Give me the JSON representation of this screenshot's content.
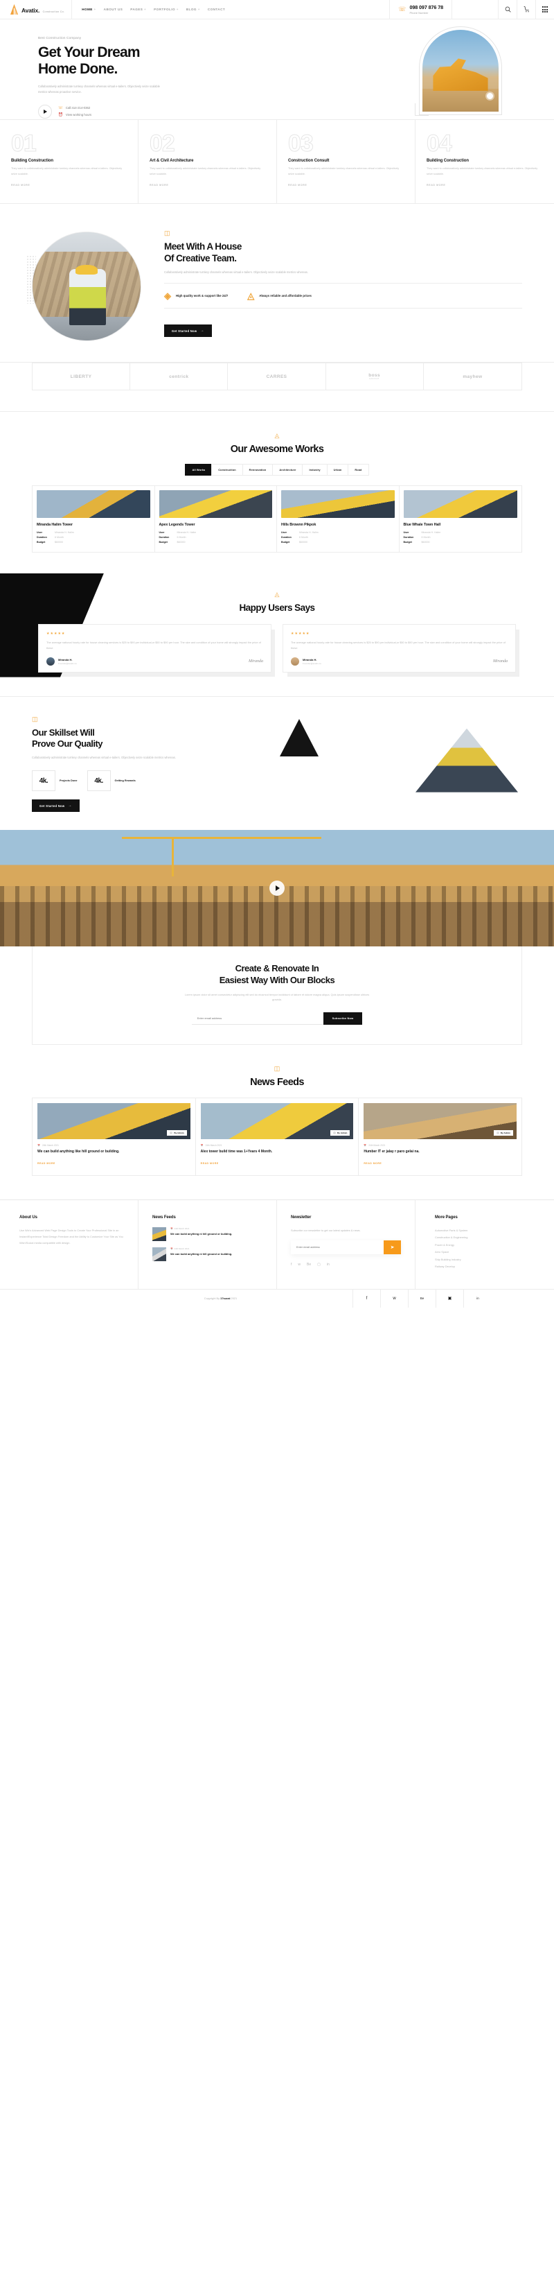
{
  "header": {
    "brand_name": "Avatix.",
    "brand_sub": "Construction Co.",
    "nav": [
      {
        "label": "HOME",
        "plus": "+",
        "active": true
      },
      {
        "label": "ABOUT US",
        "plus": "",
        "active": false
      },
      {
        "label": "PAGES",
        "plus": "+",
        "active": false
      },
      {
        "label": "PORTFOLIO",
        "plus": "+",
        "active": false
      },
      {
        "label": "BLOG",
        "plus": "+",
        "active": false
      },
      {
        "label": "CONTACT",
        "plus": "",
        "active": false
      }
    ],
    "phone_number": "098 097 876 78",
    "phone_label": "Phone Number",
    "icons": [
      "search-icon",
      "cart-icon",
      "grid-menu-icon"
    ]
  },
  "hero": {
    "eyebrow": "Best Construction Company",
    "title_line1": "Get Your Dream",
    "title_line2": "Home Done.",
    "paragraph": "Collaboratively administrate turnkey channels whereas virtual e-tailers. Objectively seize scalable metrics whereas proactive service.",
    "call_text": "Call:414-214-0362",
    "hours_text": "View working hours"
  },
  "services": [
    {
      "num": "01",
      "title": "Building Construction",
      "text": "They want to collaboratively administrate turnkey channels whereas virtual e-tailers. Objectively seize scalable.",
      "more": "READ MORE"
    },
    {
      "num": "02",
      "title": "Art & Civil Architecture",
      "text": "They want to collaboratively administrate turnkey channels whereas virtual e-tailers. Objectively seize scalable.",
      "more": "READ MORE"
    },
    {
      "num": "03",
      "title": "Construction Consult",
      "text": "They want to collaboratively administrate turnkey channels whereas virtual e-tailers. Objectively seize scalable.",
      "more": "READ MORE"
    },
    {
      "num": "04",
      "title": "Building Construction",
      "text": "They want to collaboratively administrate turnkey channels whereas virtual e-tailers. Objectively seize scalable.",
      "more": "READ MORE"
    }
  ],
  "team": {
    "title_line1": "Meet With A House",
    "title_line2": "Of Creative Team.",
    "paragraph": "Collaboratively administrate turnkey channels whereas virtual e-tailers. Objectively seize scalable metrics whereas.",
    "feature1": "High quality work & support like 24/7",
    "feature2": "Always reliable and affordable prices",
    "button": "Get Started Now"
  },
  "logos": [
    {
      "name": "LIBERTY",
      "sub": ""
    },
    {
      "name": "centrick",
      "sub": ""
    },
    {
      "name": "CARRES",
      "sub": ""
    },
    {
      "name": "boss",
      "sub": "GROUP"
    },
    {
      "name": "mayhew",
      "sub": ""
    }
  ],
  "works": {
    "title": "Our Awesome Works",
    "filters": [
      "All Works",
      "Construction",
      "Rennovation",
      "Architecture",
      "Industry",
      "Urban",
      "Road"
    ],
    "active_filter": "All Works",
    "labels": {
      "user": "User",
      "duration": "Duration",
      "budget": "Budget"
    },
    "items": [
      {
        "title": "Miranda Halim Tower",
        "user": "Miranda H. Halim",
        "duration": "6 Month",
        "budget": "$60000"
      },
      {
        "title": "Apex Legends Tower",
        "user": "Miranda H. Halim",
        "duration": "6 Month",
        "budget": "$60000"
      },
      {
        "title": "Hills Brownn Pikpok",
        "user": "Miranda H. Halim",
        "duration": "6 Month",
        "budget": "$60000"
      },
      {
        "title": "Blue Whale Town Hall",
        "user": "Miranda H. Halim",
        "duration": "6 Month",
        "budget": "$60000"
      }
    ]
  },
  "testimonials": {
    "title": "Happy Users Says",
    "stars": "★★★★★",
    "items": [
      {
        "text": "The average national hourly rate for house cleaning services is $25 to $90 per individual,or $50 to $90 per hour. The size and condition of your home will strongly impact the price of these",
        "name": "Miranda H.",
        "role": "Founder@avatix.co",
        "signature": "Miranda"
      },
      {
        "text": "The average national hourly rate for house cleaning services is $25 to $90 per individual,or $50 to $90 per hour. The size and condition of your home will strongly impact the price of these",
        "name": "Miranda H.",
        "role": "Founder@avatix.co",
        "signature": "Miranda"
      }
    ]
  },
  "skillset": {
    "title_line1": "Our Skillset Will",
    "title_line2": "Prove Our Quality",
    "paragraph": "Collaboratively administrate turnkey channels whereas virtual e-tailers. Objectively seize scalable metrics whereas.",
    "counters": [
      {
        "value": "4k.",
        "label": "Projects Done"
      },
      {
        "value": "4k.",
        "label": "Getting Rewards"
      }
    ],
    "button": "Get Started Now"
  },
  "cta_band": {
    "title_line1": "Create & Renovate In",
    "title_line2": "Easiest Way With Our Blocks",
    "paragraph": "Lorem ipsum dolor sit amet consectetur adipiscing elit sed do eiusmod tempor incididunt ut labore et dolore magna aliqua. Quis ipsum suspendisse ultrices gravida.",
    "input_placeholder": "Enter email address",
    "button": "Subscribe Now"
  },
  "news": {
    "title": "News Feeds",
    "items": [
      {
        "badge": "By Admin",
        "date": "24th March 2021",
        "title": "We can build anything like hill ground or building.",
        "more": "READ MORE"
      },
      {
        "badge": "By Admin",
        "date": "24th March 2021",
        "title": "Alex tower build time was 1+Years 4 Month.",
        "more": "READ MORE"
      },
      {
        "badge": "By Admin",
        "date": "24th March 2021",
        "title": "Humber IT er jalay r paro gelai na.",
        "more": "READ MORE"
      }
    ]
  },
  "footer": {
    "about": {
      "title": "About Us",
      "text": "Use Wix's Advanced Web Page Design Tools to Create Your Professional Site in an Instant!Experience Total Design Freedom and the Ability to Customize Your Site as You Wish!Social media compatible with design."
    },
    "news": {
      "title": "News Feeds",
      "items": [
        {
          "date": "24th March 2021",
          "title": "We can build anything ni hill ground or building."
        },
        {
          "date": "24th March 2021",
          "title": "We can build anything ni hill ground or building."
        }
      ]
    },
    "newsletter": {
      "title": "Newsletter",
      "text": "Subscribe our newsletter to get our latest updates & news.",
      "placeholder": "Enter email address",
      "send_icon": "send-icon",
      "socials": [
        "facebook-icon",
        "twitter-icon",
        "behance-icon",
        "instagram-icon",
        "linkedin-icon"
      ]
    },
    "more_pages": {
      "title": "More Pages",
      "links": [
        "Automotive Parts & System",
        "Construction & Engineering",
        "Power & Energy",
        "Aero Space",
        "Ship Building Industry",
        "Railway Develop"
      ]
    },
    "copyright_prefix": "Copyright By",
    "copyright_brand": "17sucai",
    "copyright_year": "2021",
    "bottom_socials": [
      "facebook-icon",
      "twitter-icon",
      "behance-icon",
      "instagram-icon",
      "linkedin-icon"
    ]
  },
  "colors": {
    "accent": "#f2a33c",
    "dark": "#121212",
    "orange": "#f79a1a"
  }
}
